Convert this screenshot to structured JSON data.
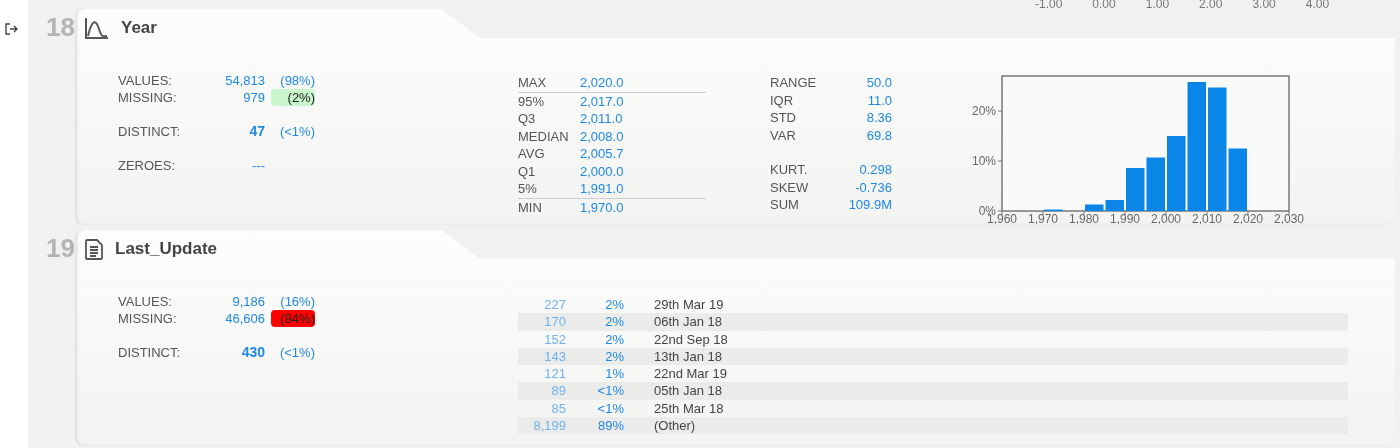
{
  "top_axis_labels": [
    "-1.00",
    "0.00",
    "1.00",
    "2.00",
    "3.00",
    "4.00"
  ],
  "columns": [
    {
      "index": "18",
      "name": "Year",
      "kind": "numeric",
      "counts": [
        {
          "kind": "values",
          "label": "VALUES:",
          "value": "54,813",
          "pct": "(98%)"
        },
        {
          "kind": "missing",
          "label": "MISSING:",
          "value": "979",
          "pct": "(2%)",
          "color": "#c8f5cc"
        },
        {
          "kind": "distinct",
          "label": "DISTINCT:",
          "value": "47",
          "pct": "(<1%)"
        },
        {
          "kind": "zeroes",
          "label": "ZEROES:",
          "value": "---"
        }
      ],
      "quantiles": [
        {
          "label": "MAX",
          "value": "2,020.0"
        },
        {
          "label": "95%",
          "value": "2,017.0"
        },
        {
          "label": "Q3",
          "value": "2,011.0"
        },
        {
          "label": "MEDIAN",
          "value": "2,008.0"
        },
        {
          "label": "AVG",
          "value": "2,005.7"
        },
        {
          "label": "Q1",
          "value": "2,000.0"
        },
        {
          "label": "5%",
          "value": "1,991.0"
        },
        {
          "label": "MIN",
          "value": "1,970.0"
        }
      ],
      "moments": [
        [
          {
            "label": "RANGE",
            "value": "50.0"
          },
          {
            "label": "IQR",
            "value": "11.0"
          },
          {
            "label": "STD",
            "value": "8.36"
          },
          {
            "label": "VAR",
            "value": "69.8"
          }
        ],
        [
          {
            "label": "KURT.",
            "value": "0.298"
          },
          {
            "label": "SKEW",
            "value": "-0.736"
          },
          {
            "label": "SUM",
            "value": "109.9M"
          }
        ]
      ],
      "chart_data": {
        "type": "bar",
        "x": [
          1972.5,
          1977.5,
          1982.5,
          1987.5,
          1992.5,
          1997.5,
          2002.5,
          2007.5,
          2012.5,
          2017.5
        ],
        "values": [
          0.3,
          0,
          1.3,
          2.2,
          8.6,
          10.7,
          15.0,
          25.8,
          24.7,
          12.5
        ],
        "xlim": [
          1960,
          2030
        ],
        "ylim": [
          0,
          27
        ],
        "xticks": [
          {
            "value": 1960,
            "label": "1,960"
          },
          {
            "value": 1970,
            "label": "1,970"
          },
          {
            "value": 1980,
            "label": "1,980"
          },
          {
            "value": 1990,
            "label": "1,990"
          },
          {
            "value": 2000,
            "label": "2,000"
          },
          {
            "value": 2010,
            "label": "2,010"
          },
          {
            "value": 2020,
            "label": "2,020"
          },
          {
            "value": 2030,
            "label": "2,030"
          }
        ],
        "yticks": [
          {
            "value": 0,
            "label": "0%"
          },
          {
            "value": 10,
            "label": "10%"
          },
          {
            "value": 20,
            "label": "20%"
          }
        ]
      }
    },
    {
      "index": "19",
      "name": "Last_Update",
      "kind": "text",
      "counts": [
        {
          "kind": "values",
          "label": "VALUES:",
          "value": "9,186",
          "pct": "(16%)"
        },
        {
          "kind": "missing",
          "label": "MISSING:",
          "value": "46,606",
          "pct": "(84%)",
          "color": "#ff0000"
        },
        {
          "kind": "distinct",
          "label": "DISTINCT:",
          "value": "430",
          "pct": "(<1%)"
        }
      ],
      "top_values": [
        {
          "count": "227",
          "pct": "2%",
          "value": "29th Mar 19"
        },
        {
          "count": "170",
          "pct": "2%",
          "value": "06th Jan 18"
        },
        {
          "count": "152",
          "pct": "2%",
          "value": "22nd Sep 18"
        },
        {
          "count": "143",
          "pct": "2%",
          "value": "13th Jan 18"
        },
        {
          "count": "121",
          "pct": "1%",
          "value": "22nd Mar 19"
        },
        {
          "count": "89",
          "pct": "<1%",
          "value": "05th Jan 18"
        },
        {
          "count": "85",
          "pct": "<1%",
          "value": "25th Mar 18"
        },
        {
          "count": "8,199",
          "pct": "89%",
          "value": "(Other)"
        }
      ]
    }
  ]
}
